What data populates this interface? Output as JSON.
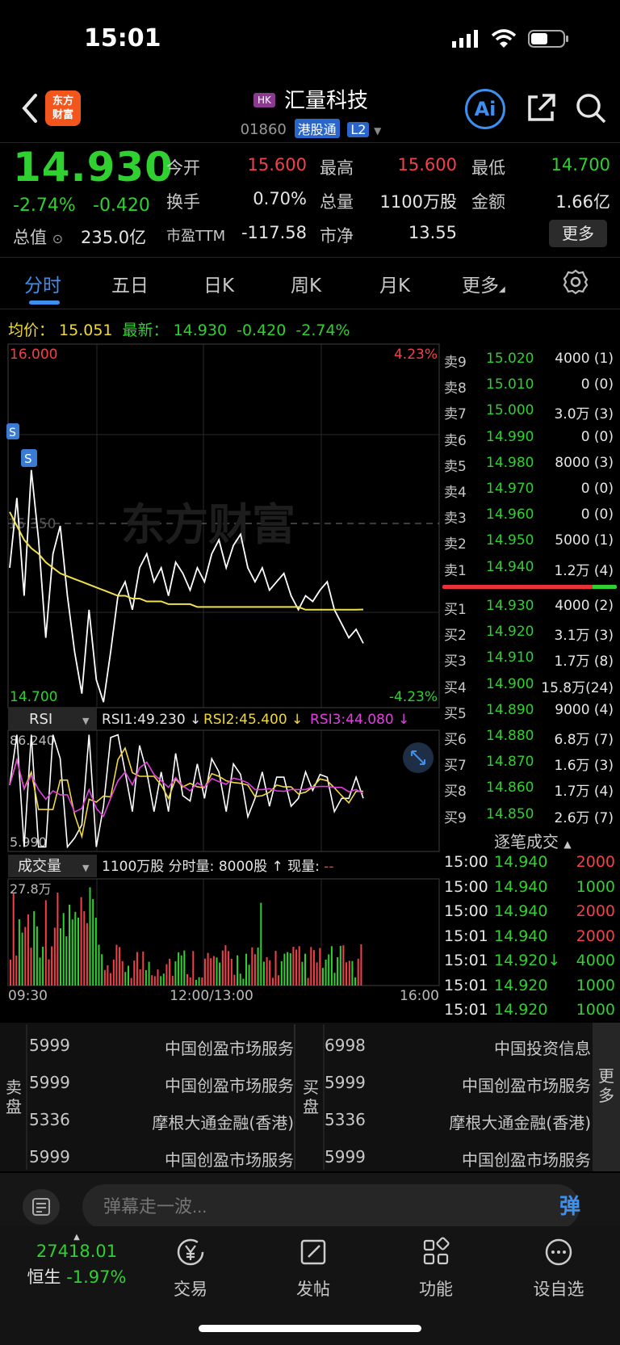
{
  "status_bar": {
    "time": "15:01"
  },
  "header": {
    "app_logo": "东方\n财富",
    "market_badge": "HK",
    "stock_name": "汇量科技",
    "stock_code": "01860",
    "tag_connect": "港股通",
    "tag_level": "L2",
    "ai_label": "Ai"
  },
  "quote": {
    "price": "14.930",
    "change_pct": "-2.74%",
    "change_abs": "-0.420",
    "total_value_label": "总值",
    "total_value": "235.0亿",
    "open_label": "今开",
    "open": "15.600",
    "high_label": "最高",
    "high": "15.600",
    "low_label": "最低",
    "low": "14.700",
    "turnover_label": "换手",
    "turnover": "0.70%",
    "volume_label": "总量",
    "volume": "1100万股",
    "amount_label": "金额",
    "amount": "1.66亿",
    "pe_label": "市盈TTM",
    "pe": "-117.58",
    "pb_label": "市净",
    "pb": "13.55",
    "more_label": "更多"
  },
  "tabs": [
    "分时",
    "五日",
    "日K",
    "周K",
    "月K",
    "更多"
  ],
  "info_line": {
    "avg_label": "均价：",
    "avg": "15.051",
    "latest_label": "最新：",
    "latest": "14.930",
    "chg": "-0.420",
    "pct": "-2.74%"
  },
  "chart_data": [
    {
      "type": "line",
      "title": "分时",
      "y_top_label": "16.000",
      "y_bottom_label": "14.700",
      "pct_top_label": "4.23%",
      "pct_bottom_label": "-4.23%",
      "mid_label": "15.350",
      "ylim": [
        14.7,
        16.0
      ],
      "series": [
        {
          "name": "最新",
          "color": "#ffffff",
          "values": [
            15.2,
            15.45,
            15.1,
            15.55,
            15.3,
            14.95,
            15.25,
            15.35,
            15.1,
            14.9,
            14.75,
            15.05,
            14.8,
            14.72,
            14.9,
            15.1,
            15.15,
            15.05,
            15.2,
            15.25,
            15.15,
            15.2,
            15.1,
            15.22,
            15.18,
            15.12,
            15.2,
            15.15,
            15.25,
            15.3,
            15.2,
            15.28,
            15.32,
            15.2,
            15.15,
            15.2,
            15.12,
            15.15,
            15.18,
            15.1,
            15.05,
            15.1,
            15.08,
            15.12,
            15.15,
            15.05,
            15.0,
            14.95,
            14.98,
            14.93
          ]
        },
        {
          "name": "均价",
          "color": "#f0e050",
          "values": [
            15.4,
            15.35,
            15.3,
            15.27,
            15.25,
            15.22,
            15.2,
            15.18,
            15.17,
            15.16,
            15.15,
            15.14,
            15.13,
            15.12,
            15.11,
            15.1,
            15.1,
            15.09,
            15.09,
            15.08,
            15.08,
            15.08,
            15.07,
            15.07,
            15.07,
            15.07,
            15.06,
            15.06,
            15.06,
            15.06,
            15.06,
            15.06,
            15.06,
            15.06,
            15.06,
            15.06,
            15.06,
            15.06,
            15.06,
            15.06,
            15.06,
            15.05,
            15.05,
            15.05,
            15.05,
            15.05,
            15.05,
            15.05,
            15.05,
            15.051
          ]
        }
      ]
    },
    {
      "type": "line",
      "title": "RSI",
      "y_top_label": "86.240",
      "y_bottom_label": "5.990",
      "ylim": [
        5.99,
        86.24
      ],
      "series": [
        {
          "name": "RSI1",
          "value_label": "RSI1:49.230 ↓",
          "color": "#ffffff"
        },
        {
          "name": "RSI2",
          "value_label": "RSI2:45.400 ↓",
          "color": "#f0d93a"
        },
        {
          "name": "RSI3",
          "value_label": "RSI3:44.080 ↓",
          "color": "#e23fe0"
        }
      ]
    },
    {
      "type": "bar",
      "title": "成交量",
      "y_top_label": "27.8万",
      "x_labels": [
        "09:30",
        "12:00/13:00",
        "16:00"
      ],
      "summary": "1100万股",
      "period_label": "分时量:",
      "period_value": "8000股 ↑",
      "current_label": "现量:",
      "current_value": "--"
    }
  ],
  "order_book": {
    "asks": [
      {
        "label": "卖9",
        "price": "15.020",
        "vol": "4000 (1)"
      },
      {
        "label": "卖8",
        "price": "15.010",
        "vol": "0 (0)"
      },
      {
        "label": "卖7",
        "price": "15.000",
        "vol": "3.0万 (3)"
      },
      {
        "label": "卖6",
        "price": "14.990",
        "vol": "0 (0)"
      },
      {
        "label": "卖5",
        "price": "14.980",
        "vol": "8000 (3)"
      },
      {
        "label": "卖4",
        "price": "14.970",
        "vol": "0 (0)"
      },
      {
        "label": "卖3",
        "price": "14.960",
        "vol": "0 (0)"
      },
      {
        "label": "卖2",
        "price": "14.950",
        "vol": "5000 (1)"
      },
      {
        "label": "卖1",
        "price": "14.940",
        "vol": "1.2万 (4)"
      }
    ],
    "bids": [
      {
        "label": "买1",
        "price": "14.930",
        "vol": "4000 (2)"
      },
      {
        "label": "买2",
        "price": "14.920",
        "vol": "3.1万 (3)"
      },
      {
        "label": "买3",
        "price": "14.910",
        "vol": "1.7万 (8)"
      },
      {
        "label": "买4",
        "price": "14.900",
        "vol": "15.8万(24)"
      },
      {
        "label": "买5",
        "price": "14.890",
        "vol": "9000 (4)"
      },
      {
        "label": "买6",
        "price": "14.880",
        "vol": "6.8万 (7)"
      },
      {
        "label": "买7",
        "price": "14.870",
        "vol": "1.6万 (3)"
      },
      {
        "label": "买8",
        "price": "14.860",
        "vol": "1.7万 (4)"
      },
      {
        "label": "买9",
        "price": "14.850",
        "vol": "2.6万 (7)"
      }
    ]
  },
  "trades": {
    "title": "逐笔成交",
    "rows": [
      {
        "time": "15:00",
        "price": "14.940",
        "vol": "2000",
        "color": "#f2404a"
      },
      {
        "time": "15:00",
        "price": "14.940",
        "vol": "1000",
        "color": "#2fd02f"
      },
      {
        "time": "15:00",
        "price": "14.940",
        "vol": "2000",
        "color": "#f2404a"
      },
      {
        "time": "15:01",
        "price": "14.940",
        "vol": "2000",
        "color": "#f2404a"
      },
      {
        "time": "15:01",
        "price": "14.920↓",
        "vol": "4000",
        "color": "#2fd02f"
      },
      {
        "time": "15:01",
        "price": "14.920",
        "vol": "1000",
        "color": "#2fd02f"
      },
      {
        "time": "15:01",
        "price": "14.920",
        "vol": "1000",
        "color": "#2fd02f"
      }
    ]
  },
  "brokers": {
    "sell_label": "卖盘",
    "buy_label": "买盘",
    "more_label": "更多",
    "sell": [
      {
        "code": "5999",
        "name": "中国创盈市场服务"
      },
      {
        "code": "5999",
        "name": "中国创盈市场服务"
      },
      {
        "code": "5336",
        "name": "摩根大通金融(香港)"
      },
      {
        "code": "5999",
        "name": "中国创盈市场服务"
      }
    ],
    "buy": [
      {
        "code": "6998",
        "name": "中国投资信息"
      },
      {
        "code": "5999",
        "name": "中国创盈市场服务"
      },
      {
        "code": "5336",
        "name": "摩根大通金融(香港)"
      },
      {
        "code": "5999",
        "name": "中国创盈市场服务"
      }
    ]
  },
  "comment": {
    "placeholder": "弹幕走一波...",
    "danmu_label": "弹"
  },
  "bottom_nav": {
    "index_value": "27418.01",
    "index_name": "恒生",
    "index_pct": "-1.97%",
    "items": [
      {
        "label": "交易",
        "icon": "yen-cycle-icon"
      },
      {
        "label": "发帖",
        "icon": "edit-icon"
      },
      {
        "label": "功能",
        "icon": "grid-icon"
      },
      {
        "label": "设自选",
        "icon": "dots-circle-icon"
      }
    ]
  },
  "watermark": "东方财富",
  "colors": {
    "up": "#f2404a",
    "down": "#2fd02f",
    "accent": "#3d8ff0",
    "avg": "#f0d93a"
  }
}
